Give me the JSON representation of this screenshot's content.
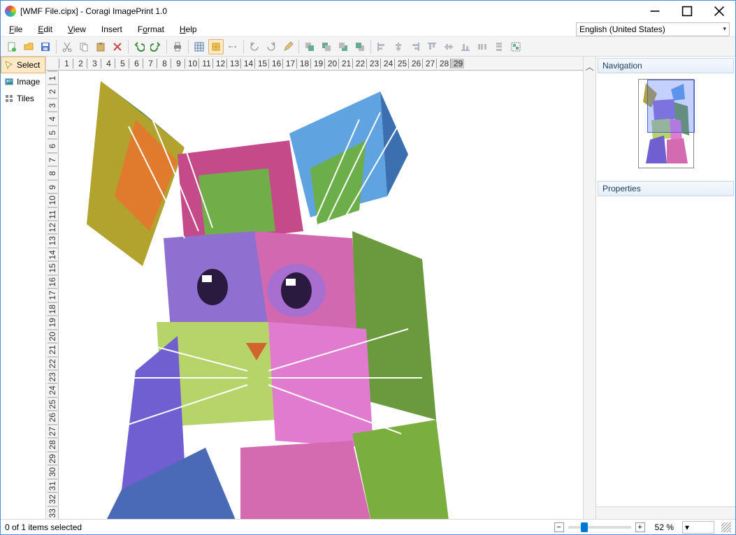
{
  "window": {
    "title": "[WMF File.cipx] - Coragi ImagePrint 1.0"
  },
  "menu": {
    "file": "File",
    "edit": "Edit",
    "view": "View",
    "insert": "Insert",
    "format": "Format",
    "help": "Help",
    "language": "English (United States)"
  },
  "sidebar": {
    "select": "Select",
    "image": "Image",
    "tiles": "Tiles"
  },
  "ruler": {
    "h": [
      "1",
      "2",
      "3",
      "4",
      "5",
      "6",
      "7",
      "8",
      "9",
      "10",
      "11",
      "12",
      "13",
      "14",
      "15",
      "16",
      "17",
      "18",
      "19",
      "20",
      "21",
      "22",
      "23",
      "24",
      "25",
      "26",
      "27",
      "28",
      "29"
    ],
    "h_current": "29",
    "v": [
      "1",
      "2",
      "3",
      "4",
      "5",
      "6",
      "7",
      "8",
      "9",
      "10",
      "11",
      "12",
      "13",
      "14",
      "15",
      "16",
      "17",
      "18",
      "19",
      "20",
      "21",
      "22",
      "23",
      "24",
      "25",
      "26",
      "27",
      "28",
      "29",
      "30",
      "31",
      "32",
      "33"
    ]
  },
  "panels": {
    "navigation": "Navigation",
    "properties": "Properties"
  },
  "status": {
    "selection": "0 of 1 items selected",
    "zoom": "52 %"
  },
  "icons": {
    "new": "new-doc",
    "open": "open",
    "save": "save",
    "cut": "cut",
    "copy": "copy",
    "paste": "paste",
    "delete": "delete",
    "undo": "undo",
    "redo": "redo",
    "print": "print",
    "grid": "grid",
    "stretch": "stretch",
    "ruler-guides": "ruler-guides",
    "rotate-l": "rotate-left",
    "rotate-r": "rotate-right",
    "pencil": "pencil",
    "send-back": "send-back",
    "send-backward": "send-backward",
    "bring-forward": "bring-forward",
    "bring-front": "bring-front",
    "align-l": "align-left",
    "align-c": "align-center",
    "align-r": "align-right",
    "align-t": "align-top",
    "align-m": "align-middle",
    "align-b": "align-bottom",
    "dist-h": "distribute-h",
    "dist-v": "distribute-v",
    "group": "group"
  }
}
